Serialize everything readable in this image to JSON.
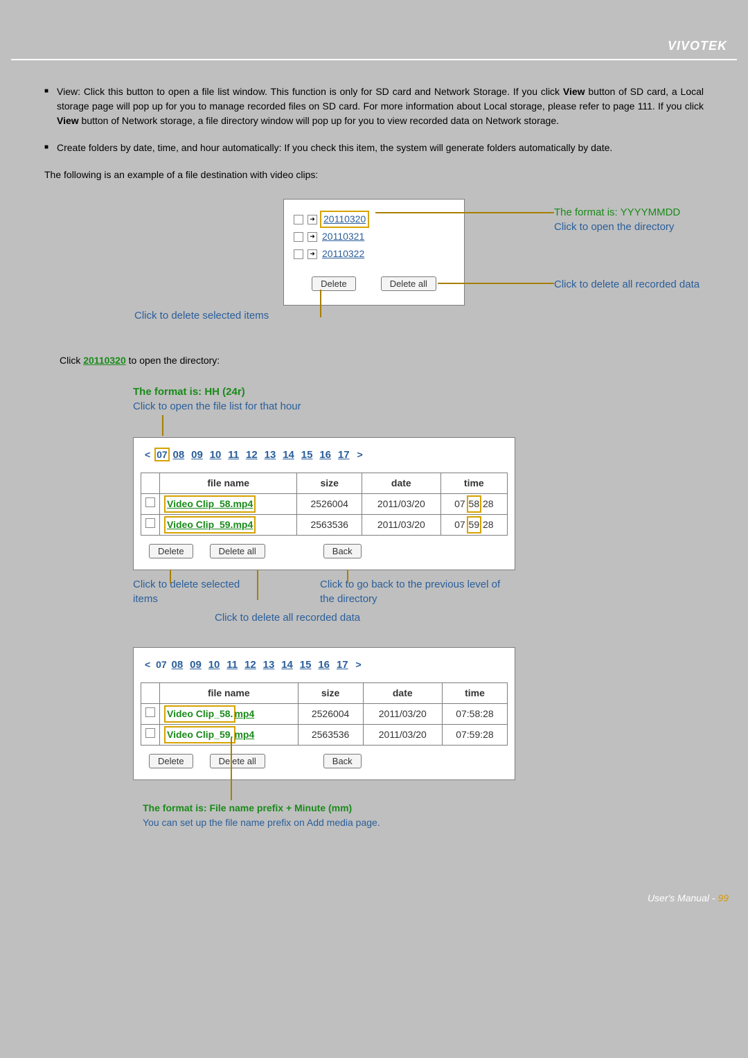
{
  "brand": "VIVOTEK",
  "bullet1_a": "View: Click this button to open a file list window. This function is only for SD card and Network Storage. If you click ",
  "bullet1_view1": "View",
  "bullet1_b": " button of SD card, a Local storage page will pop up for you to manage recorded files on SD card. For more information about Local storage, please refer to page 111. If you click ",
  "bullet1_view2": "View",
  "bullet1_c": " button of Network storage, a file directory window will pop up for you to view recorded data on Network storage.",
  "bullet2": "Create folders by date, time, and hour automatically: If you check this item, the system will generate folders automatically by date.",
  "intro": "The following is an example of a file destination with video clips:",
  "dir": {
    "items": [
      "20110320",
      "20110321",
      "20110322"
    ],
    "delete": "Delete",
    "delete_all": "Delete all"
  },
  "ann": {
    "format_green": "The format is: YYYYMMDD",
    "format_blue": "Click to open the directory",
    "delete_all": "Click to delete all recorded data",
    "delete_sel": "Click to delete selected items"
  },
  "sentence_a": "Click ",
  "sentence_link": "20110320",
  "sentence_b": " to open the directory:",
  "hh": {
    "green": "The format is: HH (24r)",
    "blue": "Click to open the file list for that hour"
  },
  "hours": [
    "07",
    "08",
    "09",
    "10",
    "11",
    "12",
    "13",
    "14",
    "15",
    "16",
    "17"
  ],
  "table": {
    "headers": {
      "fname": "file name",
      "size": "size",
      "date": "date",
      "time": "time"
    },
    "rows": [
      {
        "fname": "Video Clip_58.mp4",
        "fname_a": "Video Clip_58.",
        "fname_b": "mp4",
        "size": "2526004",
        "date": "2011/03/20",
        "time": "07:58:28",
        "th": "07",
        "tm": "58",
        "ts": "28"
      },
      {
        "fname": "Video Clip_59.mp4",
        "fname_a": "Video Clip_59.",
        "fname_b": "mp4",
        "size": "2563536",
        "date": "2011/03/20",
        "time": "07:59:28",
        "th": "07",
        "tm": "59",
        "ts": "28"
      }
    ],
    "delete": "Delete",
    "delete_all": "Delete all",
    "back": "Back"
  },
  "ann2": {
    "delete_sel": "Click to delete selected items",
    "back": "Click to go back to the previous level of the directory",
    "delete_all": "Click to delete all recorded data"
  },
  "mm": {
    "green": "The format is: File name prefix + Minute (mm)",
    "blue": "You can set up the file name prefix on Add media page."
  },
  "footer": {
    "label": "User's Manual - ",
    "page": "99"
  }
}
